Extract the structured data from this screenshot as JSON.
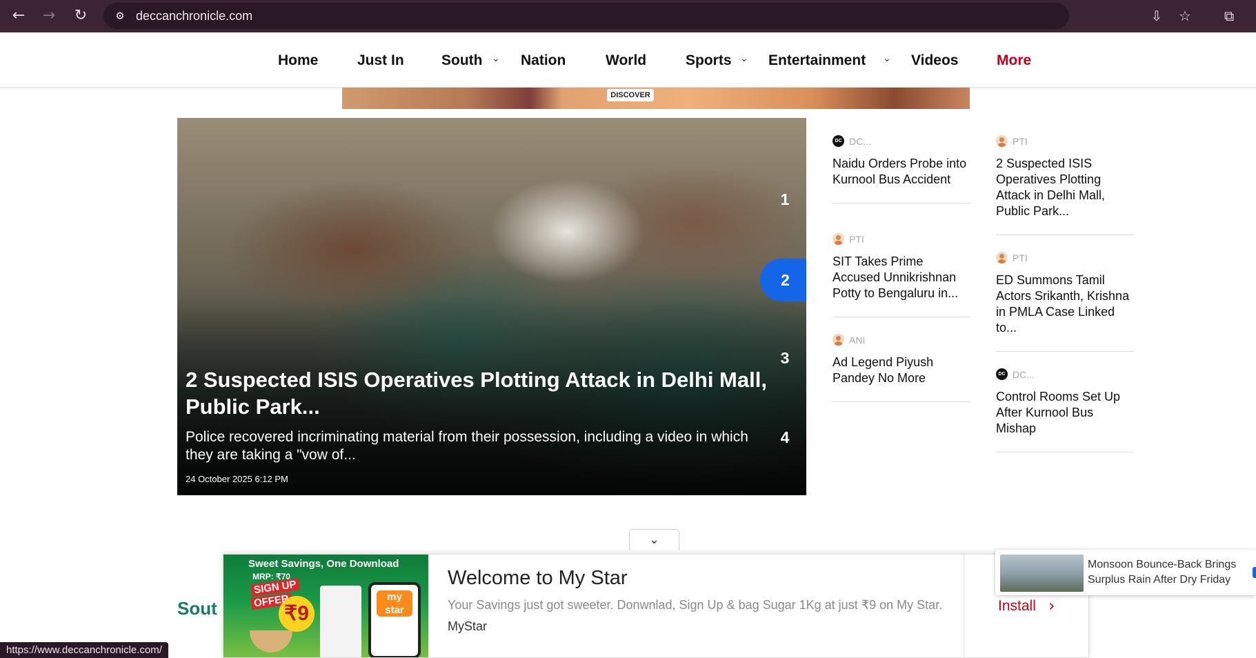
{
  "browser": {
    "url": "deccanchronicle.com",
    "status_url": "https://www.deccanchronicle.com/",
    "icons": {
      "back": "arrow-left-icon",
      "forward": "arrow-right-icon",
      "reload": "reload-icon",
      "site_info": "tune-icon",
      "install": "install-app-icon",
      "bookmark": "star-icon",
      "extensions": "puzzle-icon"
    }
  },
  "nav": {
    "items": [
      {
        "label": "Home"
      },
      {
        "label": "Just In"
      },
      {
        "label": "South",
        "dropdown": true
      },
      {
        "label": "Nation"
      },
      {
        "label": "World"
      },
      {
        "label": "Sports",
        "dropdown": true
      },
      {
        "label": "Entertainment",
        "dropdown": true
      },
      {
        "label": "Videos"
      },
      {
        "label": "More",
        "accent": true
      }
    ],
    "accent_color": "#c0001c"
  },
  "ad_banner": {
    "cta": "DISCOVER"
  },
  "hero": {
    "title": "2 Suspected ISIS Operatives Plotting Attack in Delhi Mall, Public Park...",
    "description": "Police recovered incriminating material from their possession, including a video in which they are taking a \"vow of...",
    "date": "24 October 2025 6:12 PM",
    "slides": [
      "1",
      "2",
      "3",
      "4"
    ],
    "active_slide": "2",
    "active_color": "#1565e8"
  },
  "news": {
    "left": [
      {
        "source": "DC...",
        "source_type": "logo",
        "title": "Naidu Orders Probe into Kurnool Bus Accident"
      },
      {
        "source": "PTI",
        "source_type": "avatar",
        "title": "SIT Takes Prime Accused Unnikrishnan Potty to Bengaluru in..."
      },
      {
        "source": "ANI",
        "source_type": "avatar",
        "title": "Ad Legend Piyush Pandey No More"
      }
    ],
    "right": [
      {
        "source": "PTI",
        "source_type": "avatar",
        "title": "2 Suspected ISIS Operatives Plotting Attack in Delhi Mall, Public Park..."
      },
      {
        "source": "PTI",
        "source_type": "avatar",
        "title": "ED Summons Tamil Actors Srikanth, Krishna in PMLA Case Linked to..."
      },
      {
        "source": "DC...",
        "source_type": "logo",
        "title": "Control Rooms Set Up After Kurnool Bus Mishap"
      }
    ]
  },
  "section_peek": "Sout",
  "bottom_ad": {
    "creative": {
      "line1": "Sweet Savings, One Download",
      "mrp": "MRP: ₹70",
      "signup": "SIGN UP",
      "offer": "OFFER",
      "price": "₹9",
      "app_name": "my star"
    },
    "headline": "Welcome to My Star",
    "description": "Your Savings just got sweeter. Donwnlad, Sign Up & bag Sugar 1Kg at just ₹9 on My Star.",
    "brand": "MyStar",
    "cta": "Install",
    "cta_color": "#d0021b"
  },
  "toast": {
    "title": "Monsoon Bounce-Back Brings Surplus Rain After Dry Friday"
  }
}
